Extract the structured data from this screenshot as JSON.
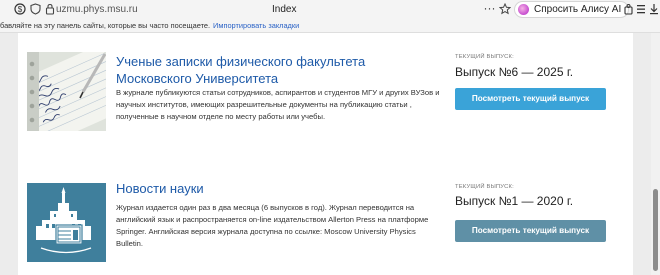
{
  "browser": {
    "url": "uzmu.phys.msu.ru",
    "tab_title": "Index",
    "alice_button": "Спросить Алису AI"
  },
  "bookmarks_bar": {
    "text": "бавляйте на эту панель сайты, которые вы часто посещаете.",
    "link": "Импортировать закладки"
  },
  "cards": [
    {
      "title_line1": "Ученые записки физического факультета",
      "title_line2": "Московского Университета",
      "description": "В журнале публикуются статьи сотрудников, аспирантов и студентов МГУ и других ВУЗов и научных институтов, имеющих разрешительные документы на публикацию статьи , полученные в научном отделе по месту работы или учебы.",
      "issue_label": "ТЕКУЩИЙ ВЫПУСК:",
      "issue_title": "Выпуск №6 — 2025 г.",
      "button": "Посмотреть текущий выпуск",
      "button_color": "#3aa3d8"
    },
    {
      "title_line1": "Новости науки",
      "description": "Журнал издается один раз в два месяца (6 выпусков в год). Журнал переводится на английский язык и распространяется on-line издательством Allerton Press на платформе Springer. Английская версия журнала доступна по ссылке: Moscow University Physics Bulletin.",
      "issue_label": "ТЕКУЩИЙ ВЫПУСК:",
      "issue_title": "Выпуск №1 — 2020 г.",
      "button": "Посмотреть текущий выпуск",
      "button_color": "#5f90a6"
    }
  ],
  "icons": [
    "site-info-icon",
    "shield-icon",
    "lock-icon",
    "more-icon",
    "bookmark-star-icon",
    "alice-icon",
    "extensions-icon",
    "menu-icon",
    "download-icon",
    "notebook-photo-icon",
    "msu-logo-icon"
  ]
}
